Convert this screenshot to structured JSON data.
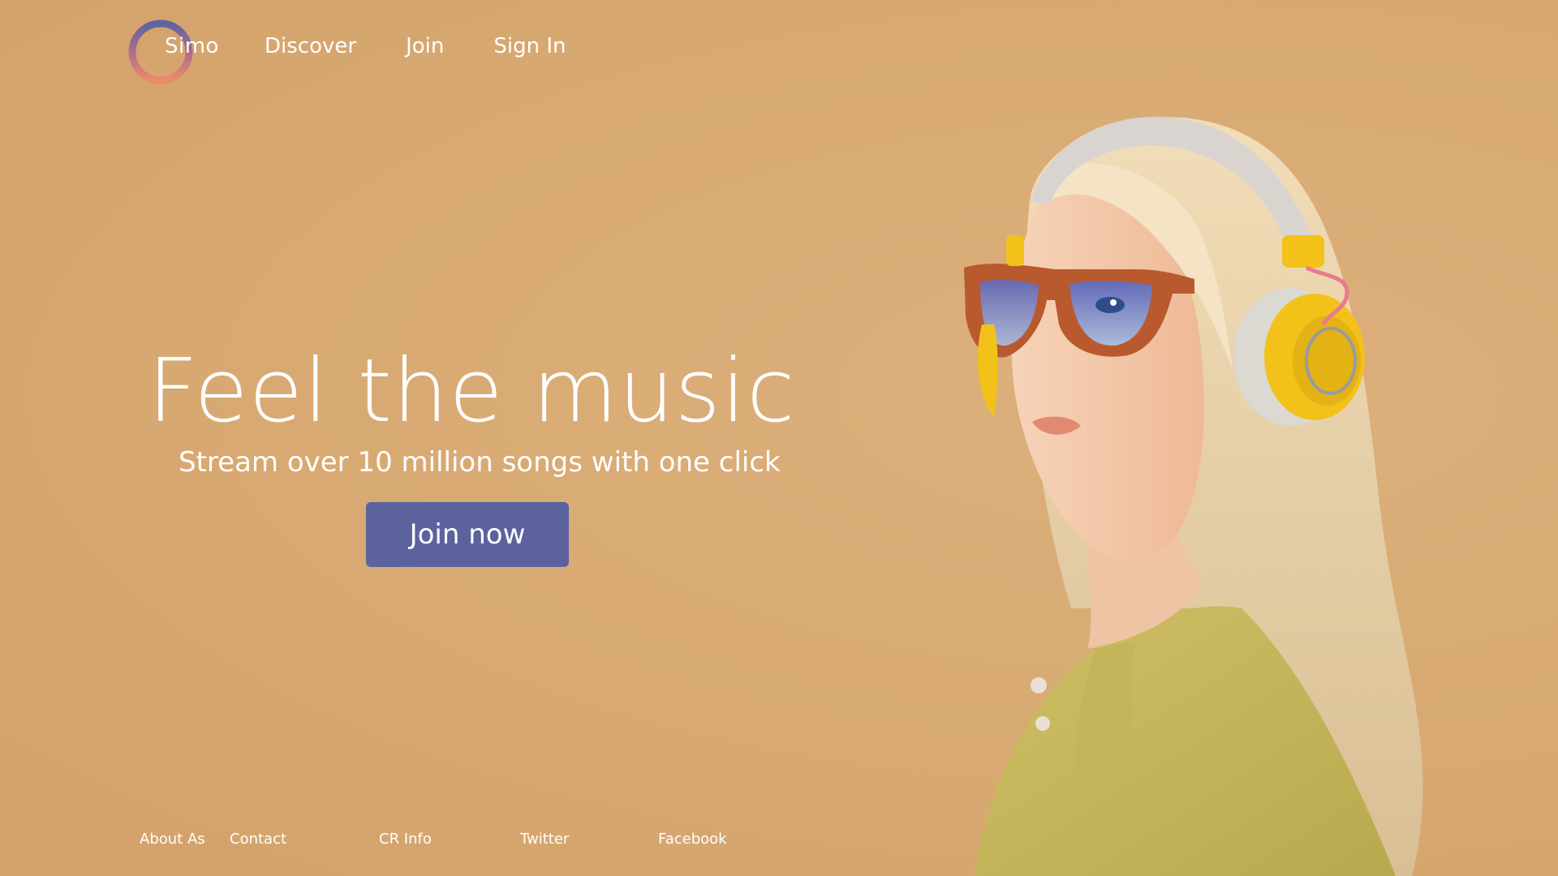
{
  "brand": {
    "name": "Simo",
    "logo_icon": "ring-logo-icon"
  },
  "nav": {
    "items": [
      {
        "label": "Discover"
      },
      {
        "label": "Join"
      },
      {
        "label": "Sign In"
      }
    ]
  },
  "hero": {
    "title": "Feel the music",
    "subtitle": "Stream over 10 million songs with one click",
    "cta_label": "Join now"
  },
  "footer": {
    "links": [
      {
        "label": "About As"
      },
      {
        "label": "Contact"
      },
      {
        "label": "CR Info"
      },
      {
        "label": "Twitter"
      },
      {
        "label": "Facebook"
      }
    ]
  },
  "colors": {
    "background": "#d9ab75",
    "button": "#5c629d",
    "text": "#ffffff",
    "logo_gradient_start": "#5f63a3",
    "logo_gradient_end": "#e8856e"
  }
}
